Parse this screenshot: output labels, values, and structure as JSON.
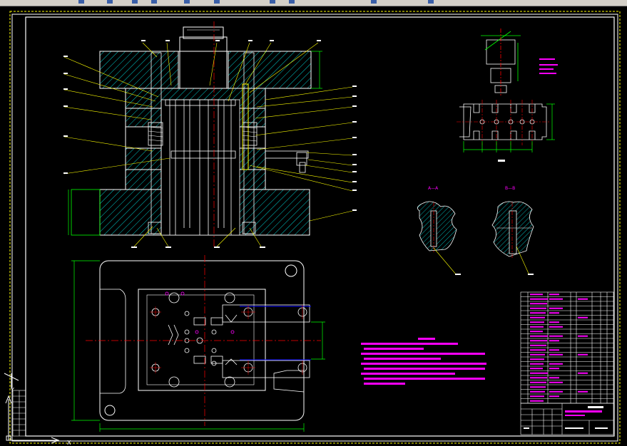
{
  "toolbar": {
    "icons": [
      "toolbar-icon-1",
      "toolbar-icon-2",
      "toolbar-icon-3",
      "toolbar-icon-4",
      "toolbar-icon-5",
      "toolbar-icon-6",
      "toolbar-icon-7",
      "toolbar-icon-8",
      "toolbar-icon-9",
      "toolbar-icon-10"
    ]
  },
  "drawing": {
    "section_labels": [
      "A—A",
      "B—B"
    ],
    "colors": {
      "background": "#000000",
      "frame": "#ffffff",
      "border_dashed": "#ffff00",
      "hatch": "#00ffff",
      "leader": "#ffff00",
      "centerline": "#ff0000",
      "notes": "#ff00ff",
      "dimension": "#00ff00",
      "parts": "#ffffff"
    },
    "ucs_axes": [
      "X",
      "Y"
    ]
  }
}
